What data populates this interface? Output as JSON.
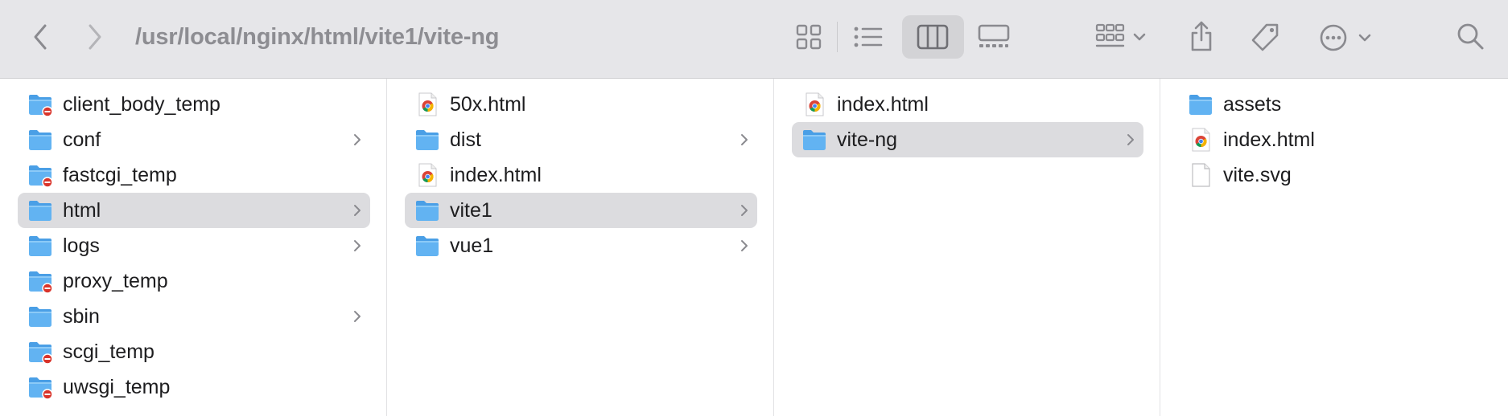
{
  "toolbar": {
    "path": "/usr/local/nginx/html/vite1/vite-ng",
    "icons": [
      "back-icon",
      "forward-icon",
      "icon-view-icon",
      "list-view-icon",
      "column-view-icon",
      "gallery-view-icon",
      "group-icon",
      "share-icon",
      "tag-icon",
      "more-icon",
      "search-icon"
    ],
    "active_view": "column"
  },
  "columns": [
    {
      "items": [
        {
          "label": "client_body_temp",
          "icon": "folder-restricted",
          "chevron": false,
          "selected": false
        },
        {
          "label": "conf",
          "icon": "folder",
          "chevron": true,
          "selected": false
        },
        {
          "label": "fastcgi_temp",
          "icon": "folder-restricted",
          "chevron": false,
          "selected": false
        },
        {
          "label": "html",
          "icon": "folder",
          "chevron": true,
          "selected": true
        },
        {
          "label": "logs",
          "icon": "folder",
          "chevron": true,
          "selected": false
        },
        {
          "label": "proxy_temp",
          "icon": "folder-restricted",
          "chevron": false,
          "selected": false
        },
        {
          "label": "sbin",
          "icon": "folder",
          "chevron": true,
          "selected": false
        },
        {
          "label": "scgi_temp",
          "icon": "folder-restricted",
          "chevron": false,
          "selected": false
        },
        {
          "label": "uwsgi_temp",
          "icon": "folder-restricted",
          "chevron": false,
          "selected": false
        }
      ]
    },
    {
      "items": [
        {
          "label": "50x.html",
          "icon": "html-file",
          "chevron": false,
          "selected": false
        },
        {
          "label": "dist",
          "icon": "folder",
          "chevron": true,
          "selected": false
        },
        {
          "label": "index.html",
          "icon": "html-file",
          "chevron": false,
          "selected": false
        },
        {
          "label": "vite1",
          "icon": "folder",
          "chevron": true,
          "selected": true
        },
        {
          "label": "vue1",
          "icon": "folder",
          "chevron": true,
          "selected": false
        }
      ]
    },
    {
      "items": [
        {
          "label": "index.html",
          "icon": "html-file",
          "chevron": false,
          "selected": false
        },
        {
          "label": "vite-ng",
          "icon": "folder",
          "chevron": true,
          "selected": true
        }
      ]
    },
    {
      "items": [
        {
          "label": "assets",
          "icon": "folder",
          "chevron": false,
          "selected": false
        },
        {
          "label": "index.html",
          "icon": "html-file",
          "chevron": false,
          "selected": false
        },
        {
          "label": "vite.svg",
          "icon": "blank-file",
          "chevron": false,
          "selected": false
        }
      ]
    }
  ],
  "colors": {
    "toolbar_bg": "#e6e6e9",
    "selection_bg": "#dcdcdf",
    "folder_blue": "#5aaef0",
    "restricted_red": "#d9342b",
    "icon_gray": "#8a8a8f"
  }
}
